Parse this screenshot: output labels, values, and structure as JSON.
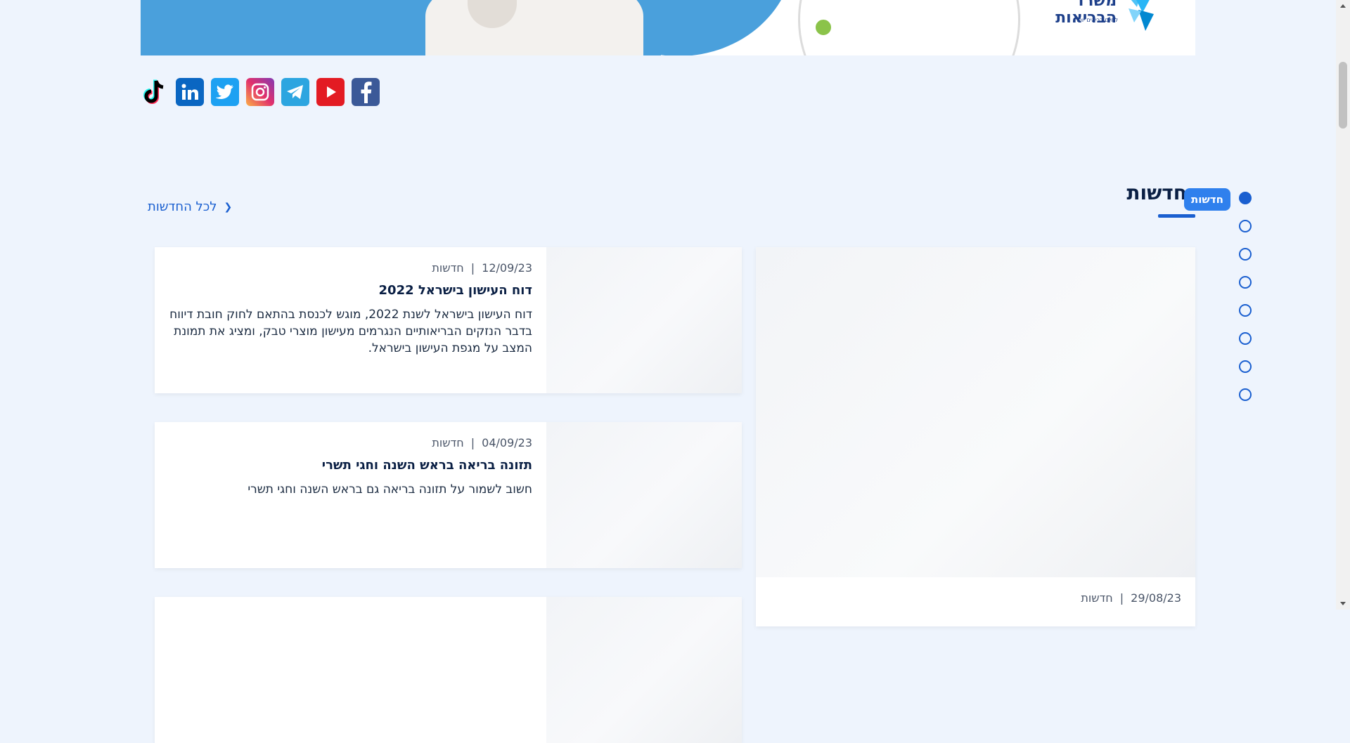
{
  "hero": {
    "logo_text": "משרד הבריאות",
    "logo_subtext": "לחיים בריאים יותר"
  },
  "social": [
    {
      "name": "tiktok-icon",
      "label": "TikTok"
    },
    {
      "name": "linkedin-icon",
      "label": "LinkedIn"
    },
    {
      "name": "twitter-icon",
      "label": "Twitter"
    },
    {
      "name": "instagram-icon",
      "label": "Instagram"
    },
    {
      "name": "telegram-icon",
      "label": "Telegram"
    },
    {
      "name": "youtube-icon",
      "label": "YouTube"
    },
    {
      "name": "facebook-icon",
      "label": "Facebook"
    }
  ],
  "section": {
    "title": "חדשות",
    "tooltip": "חדשות",
    "all_news_link": "לכל החדשות"
  },
  "cards": [
    {
      "date": "12/09/23",
      "category": "חדשות",
      "title": "דוח העישון בישראל 2022",
      "description": "דוח העישון בישראל לשנת 2022, מוגש לכנסת בהתאם לחוק חובת דיווח בדבר הנזקים הבריאותיים הנגרמים מעישון מוצרי טבק, ומציג את תמונת המצב על מגפת העישון בישראל."
    },
    {
      "date": "04/09/23",
      "category": "חדשות",
      "title": "תזונה בריאה בראש השנה וחגי תשרי",
      "description": "חשוב לשמור על תזונה בריאה גם בראש השנה וחגי תשרי"
    }
  ],
  "big_card": {
    "date": "29/08/23",
    "category": "חדשות"
  },
  "colors": {
    "page_bg": "#eef4fd",
    "accent": "#1a5fd0",
    "tooltip_bg": "#2f80ed"
  }
}
